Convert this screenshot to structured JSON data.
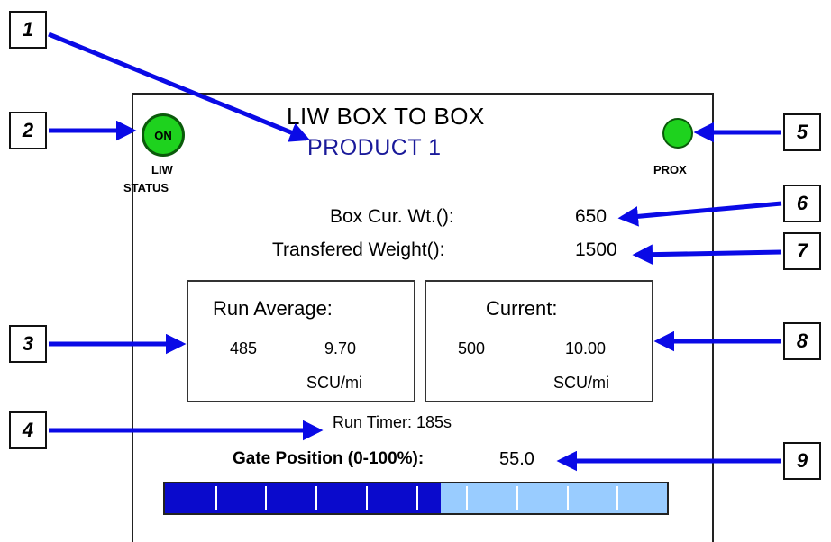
{
  "screen": {
    "title": "LIW BOX TO BOX",
    "product": "PRODUCT 1",
    "liw_status": {
      "led_text": "ON",
      "label_line1": "LIW",
      "label_line2": "STATUS",
      "color": "#1ed21e"
    },
    "prox": {
      "label": "PROX",
      "color": "#1ed21e"
    },
    "box_cur_wt": {
      "label": "Box Cur. Wt.():",
      "value": "650"
    },
    "transfered_weight": {
      "label": "Transfered Weight():",
      "value": "1500"
    },
    "run_average": {
      "title": "Run Average:",
      "value_a": "485",
      "value_b": "9.70",
      "unit": "SCU/mi"
    },
    "current": {
      "title": "Current:",
      "value_a": "500",
      "value_b": "10.00",
      "unit": "SCU/mi"
    },
    "run_timer": "Run Timer: 185s",
    "gate_position": {
      "label": "Gate Position (0-100%):",
      "value": "55.0",
      "fill_fraction": 0.55
    },
    "colors": {
      "bar_fill": "#0a0acc",
      "bar_empty": "#99ccff",
      "arrow": "#0a0ae6",
      "product_text": "#1a1a9a"
    }
  },
  "callouts": [
    "1",
    "2",
    "3",
    "4",
    "5",
    "6",
    "7",
    "8",
    "9"
  ]
}
